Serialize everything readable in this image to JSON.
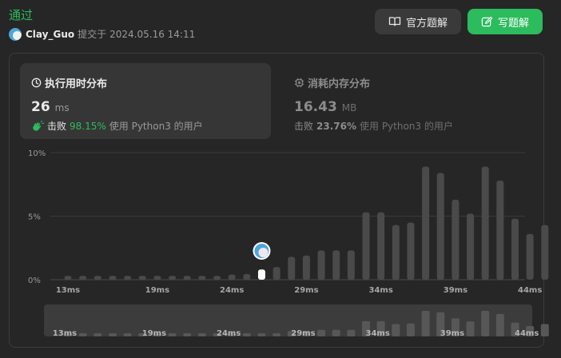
{
  "status": "通过",
  "submission": {
    "user": "Clay_Guo",
    "submitted_prefix": "提交于",
    "datetime": "2024.05.16 14:11"
  },
  "buttons": {
    "official_solution": "官方题解",
    "write_solution": "写题解"
  },
  "runtime_card": {
    "title": "执行用时分布",
    "value": "26",
    "unit": "ms",
    "beat_word": "击败",
    "beat_pct": "98.15%",
    "beat_suffix": "使用 Python3 的用户"
  },
  "memory_card": {
    "title": "消耗内存分布",
    "value": "16.43",
    "unit": "MB",
    "beat_word": "击败",
    "beat_pct": "23.76%",
    "beat_suffix": "使用 Python3 的用户"
  },
  "colors": {
    "accent": "#2cbb5d",
    "bar": "#4a4a4a",
    "highlight_bar": "#ffffff"
  },
  "chart_data": {
    "type": "bar",
    "title": "",
    "xlabel": "",
    "ylabel": "",
    "x_unit": "ms",
    "y_unit": "%",
    "ylim": [
      0,
      10
    ],
    "y_ticks": [
      "0%",
      "5%",
      "10%"
    ],
    "x": [
      13,
      14,
      15,
      16,
      17,
      18,
      19,
      20,
      21,
      22,
      23,
      24,
      25,
      26,
      27,
      28,
      29,
      30,
      31,
      32,
      33,
      34,
      35,
      36,
      37,
      38,
      39,
      40,
      41,
      42,
      43,
      44
    ],
    "values": [
      0.3,
      0.3,
      0.3,
      0.3,
      0.3,
      0.3,
      0.3,
      0.3,
      0.3,
      0.3,
      0.3,
      0.4,
      0.45,
      0.8,
      1.0,
      1.8,
      1.9,
      2.3,
      2.3,
      2.3,
      5.3,
      5.3,
      4.3,
      4.5,
      8.9,
      8.4,
      6.3,
      5.2,
      8.9,
      7.8,
      4.8,
      3.6,
      4.3
    ],
    "x_tick_labels": [
      "13ms",
      "19ms",
      "24ms",
      "29ms",
      "34ms",
      "39ms",
      "44ms"
    ],
    "highlight_x": 26,
    "highlight_user": "Clay_Guo",
    "grid": true,
    "legend": "none"
  }
}
